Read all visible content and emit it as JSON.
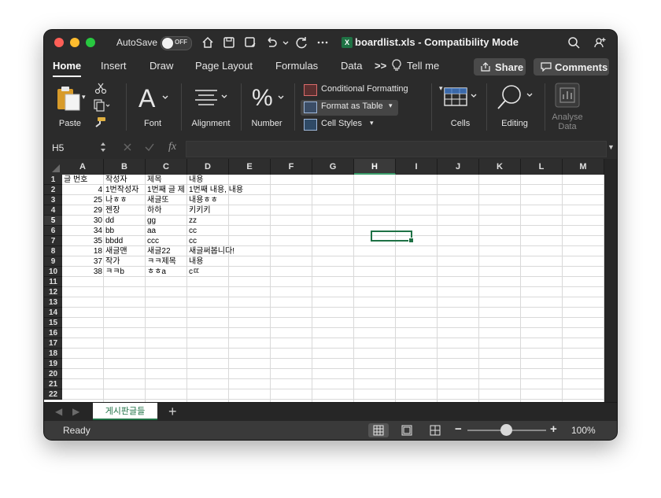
{
  "titlebar": {
    "autosave_label": "AutoSave",
    "autosave_state": "OFF",
    "xls_icon_letter": "X",
    "doc_title": "boardlist.xls  -  Compatibility Mode",
    "icons": [
      "home-icon",
      "save-icon",
      "save-as-icon",
      "undo-icon",
      "redo-icon",
      "more-icon",
      "search-icon",
      "share-people-icon"
    ]
  },
  "tabs": {
    "items": [
      "Home",
      "Insert",
      "Draw",
      "Page Layout",
      "Formulas",
      "Data"
    ],
    "overflow": ">>",
    "tell_me": "Tell me",
    "share": "Share",
    "comments": "Comments"
  },
  "ribbon": {
    "paste": "Paste",
    "font": "Font",
    "alignment": "Alignment",
    "number": "Number",
    "conditional_formatting": "Conditional Formatting",
    "format_as_table": "Format as Table",
    "cell_styles": "Cell Styles",
    "cells": "Cells",
    "editing": "Editing",
    "analyse": "Analyse",
    "data": "Data"
  },
  "formula_bar": {
    "name_box": "H5",
    "fx": "fx",
    "value": ""
  },
  "sheet": {
    "columns": [
      "A",
      "B",
      "C",
      "D",
      "E",
      "F",
      "G",
      "H",
      "I",
      "J",
      "K",
      "L",
      "M"
    ],
    "selected_column": "H",
    "selected_row": 5,
    "rows": [
      "1",
      "2",
      "3",
      "4",
      "5",
      "6",
      "7",
      "8",
      "9",
      "10",
      "11",
      "12",
      "13",
      "14",
      "15",
      "16",
      "17",
      "18",
      "19",
      "20",
      "21",
      "22"
    ],
    "data": [
      [
        "글 번호",
        "작성자",
        "제목",
        "내용"
      ],
      [
        "4",
        "1번작성자",
        "1번째 글 제",
        "1번째 내용, 내용"
      ],
      [
        "25",
        "나ㅎㅎ",
        "새글또",
        "내용ㅎㅎ"
      ],
      [
        "29",
        "젠장",
        "하하",
        "키키키"
      ],
      [
        "30",
        "dd",
        "gg",
        "zz"
      ],
      [
        "34",
        "bb",
        "aa",
        "cc"
      ],
      [
        "35",
        "bbdd",
        "ccc",
        "cc"
      ],
      [
        "18",
        "새글맨",
        "새글22",
        "새글써봅니다!"
      ],
      [
        "37",
        "작가",
        "ㅋㅋ제목",
        "내용"
      ],
      [
        "38",
        "ㅋㅋb",
        "ㅎㅎa",
        "cㄸ"
      ]
    ]
  },
  "sheet_tabs": {
    "active": "게시판글들",
    "add": "+"
  },
  "statusbar": {
    "status": "Ready",
    "zoom": "100%",
    "zoom_minus": "−",
    "zoom_plus": "+"
  }
}
